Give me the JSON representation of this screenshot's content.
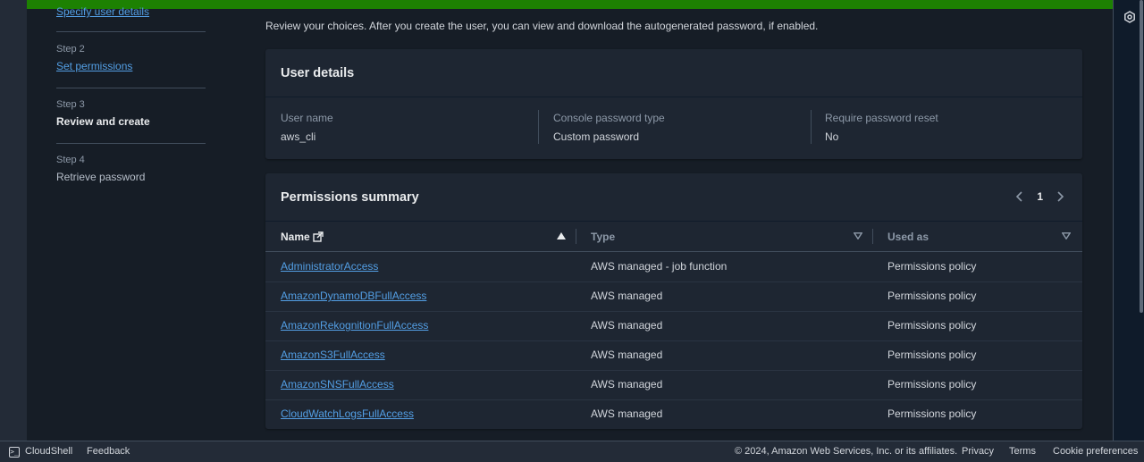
{
  "steps": {
    "step1_label": "Specify user details",
    "items": [
      {
        "num": "Step 2",
        "label": "Set permissions"
      },
      {
        "num": "Step 3",
        "label": "Review and create"
      },
      {
        "num": "Step 4",
        "label": "Retrieve password"
      }
    ]
  },
  "intro": "Review your choices. After you create the user, you can view and download the autogenerated password, if enabled.",
  "user_details": {
    "title": "User details",
    "fields": [
      {
        "key": "User name",
        "value": "aws_cli"
      },
      {
        "key": "Console password type",
        "value": "Custom password"
      },
      {
        "key": "Require password reset",
        "value": "No"
      }
    ]
  },
  "permissions": {
    "title": "Permissions summary",
    "page": "1",
    "columns": [
      "Name",
      "Type",
      "Used as"
    ],
    "rows": [
      {
        "name": "AdministratorAccess",
        "type": "AWS managed - job function",
        "used_as": "Permissions policy"
      },
      {
        "name": "AmazonDynamoDBFullAccess",
        "type": "AWS managed",
        "used_as": "Permissions policy"
      },
      {
        "name": "AmazonRekognitionFullAccess",
        "type": "AWS managed",
        "used_as": "Permissions policy"
      },
      {
        "name": "AmazonS3FullAccess",
        "type": "AWS managed",
        "used_as": "Permissions policy"
      },
      {
        "name": "AmazonSNSFullAccess",
        "type": "AWS managed",
        "used_as": "Permissions policy"
      },
      {
        "name": "CloudWatchLogsFullAccess",
        "type": "AWS managed",
        "used_as": "Permissions policy"
      }
    ]
  },
  "footer": {
    "cloudshell": "CloudShell",
    "feedback": "Feedback",
    "copyright": "© 2024, Amazon Web Services, Inc. or its affiliates.",
    "privacy": "Privacy",
    "terms": "Terms",
    "cookies": "Cookie preferences"
  },
  "icons": {
    "settings": "settings-icon",
    "external": "external-link-icon",
    "sort_asc": "sort-ascending-icon",
    "sort_desc": "sort-descending-icon",
    "prev": "chevron-left-icon",
    "next": "chevron-right-icon",
    "cloudshell": "cloudshell-icon"
  },
  "colors": {
    "flash": "#1d8102",
    "link": "#539fe5",
    "panel": "#1e2632",
    "background": "#161d26"
  }
}
